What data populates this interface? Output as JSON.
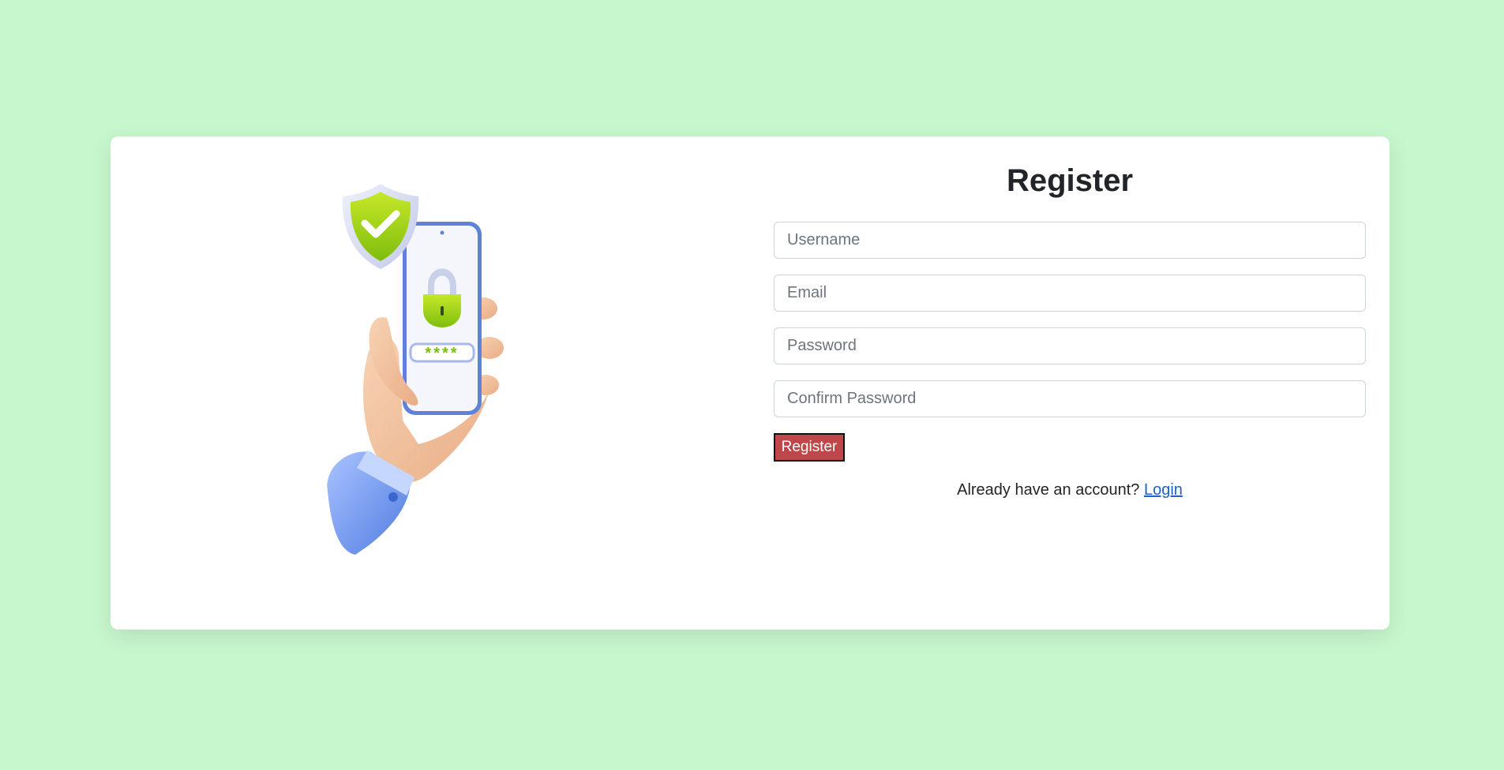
{
  "form": {
    "title": "Register",
    "fields": [
      {
        "name": "username",
        "placeholder": "Username",
        "value": ""
      },
      {
        "name": "email",
        "placeholder": "Email",
        "value": ""
      },
      {
        "name": "password",
        "placeholder": "Password",
        "value": ""
      },
      {
        "name": "confirm_password",
        "placeholder": "Confirm Password",
        "value": ""
      }
    ],
    "submit_label": "Register",
    "login_prompt": "Already have an account?",
    "login_link": "Login"
  },
  "colors": {
    "background": "#c7f7cd",
    "card": "#ffffff",
    "button": "#c0464a",
    "link": "#2160c4"
  },
  "illustration": {
    "icons": [
      "hand-holding-phone-icon",
      "shield-check-icon",
      "padlock-icon",
      "password-dots-icon"
    ],
    "password_mask": "****"
  }
}
